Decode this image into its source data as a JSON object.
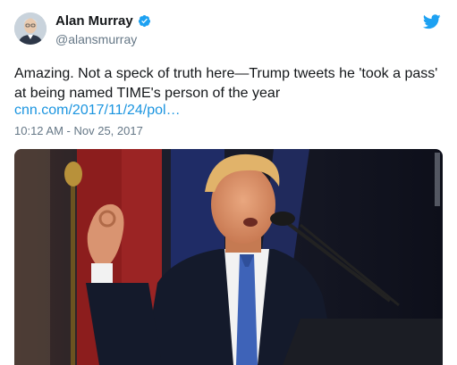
{
  "author": {
    "name": "Alan Murray",
    "handle": "@alansmurray",
    "verified_icon": "verified-badge-icon",
    "avatar_icon": "profile-photo"
  },
  "tweet": {
    "text": "Amazing. Not a speck of truth here—Trump tweets he 'took a pass' at being named TIME's person of the year",
    "link": "cnn.com/2017/11/24/pol…",
    "timestamp": "10:12 AM - Nov 25, 2017"
  },
  "media": {
    "description_icon": "photo-speaker-at-podium"
  },
  "colors": {
    "accent": "#1da1f2",
    "link": "#1b95e0",
    "secondary_text": "#657786"
  }
}
